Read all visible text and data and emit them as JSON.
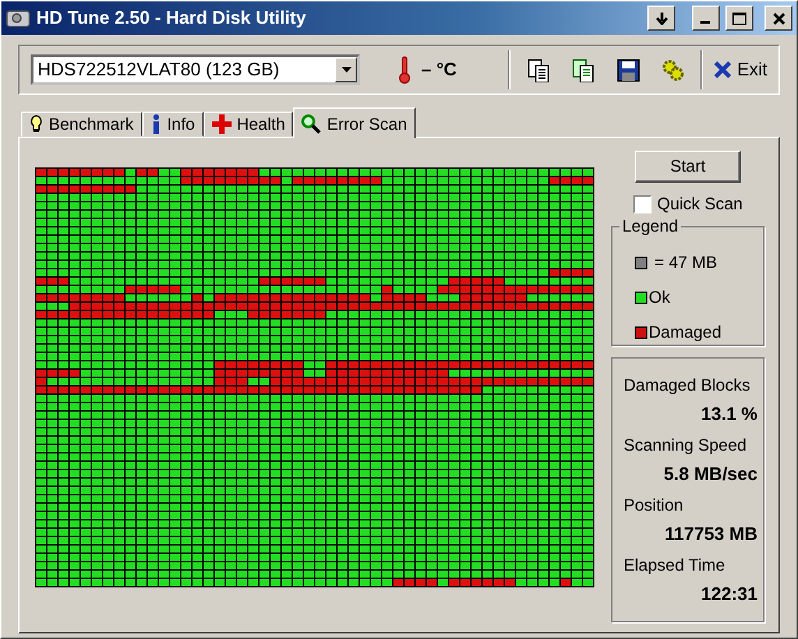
{
  "window": {
    "title": "HD Tune 2.50 - Hard Disk Utility"
  },
  "toolbar": {
    "drive": "HDS722512VLAT80 (123 GB)",
    "temperature": "– °C",
    "exit": "Exit"
  },
  "tabs": [
    {
      "label": "Benchmark",
      "selected": false
    },
    {
      "label": "Info",
      "selected": false
    },
    {
      "label": "Health",
      "selected": false
    },
    {
      "label": "Error Scan",
      "selected": true
    }
  ],
  "scan_map": {
    "rows": [
      [
        true,
        true,
        true,
        true,
        true,
        true,
        true,
        true,
        false,
        true,
        true,
        false,
        false,
        true,
        true,
        true,
        true,
        true,
        true,
        true,
        false,
        false,
        false,
        false,
        false,
        false,
        false,
        false,
        false,
        false,
        false,
        false,
        false,
        false,
        false,
        false,
        false,
        false,
        false,
        false,
        false,
        false,
        false,
        false,
        false,
        false,
        false,
        false,
        false,
        false
      ],
      [
        false,
        false,
        false,
        false,
        false,
        false,
        false,
        false,
        false,
        false,
        false,
        false,
        false,
        true,
        true,
        true,
        true,
        true,
        true,
        true,
        true,
        true,
        false,
        true,
        true,
        true,
        true,
        true,
        true,
        true,
        true,
        false,
        false,
        false,
        false,
        false,
        false,
        false,
        false,
        false,
        false,
        false,
        false,
        false,
        false,
        false,
        true,
        true,
        true,
        true
      ],
      [
        true,
        true,
        true,
        true,
        true,
        true,
        true,
        true,
        true,
        false,
        false,
        false,
        false,
        false,
        false,
        false,
        false,
        false,
        false,
        false,
        false,
        false,
        false,
        false,
        false,
        false,
        false,
        false,
        false,
        false,
        false,
        false,
        false,
        false,
        false,
        false,
        false,
        false,
        false,
        false,
        false,
        false,
        false,
        false,
        false,
        false,
        false,
        false,
        false,
        false
      ],
      [
        false,
        false,
        false,
        false,
        false,
        false,
        false,
        false,
        false,
        false,
        false,
        false,
        false,
        false,
        false,
        false,
        false,
        false,
        false,
        false,
        false,
        false,
        false,
        false,
        false,
        false,
        false,
        false,
        false,
        false,
        false,
        false,
        false,
        false,
        false,
        false,
        false,
        false,
        false,
        false,
        false,
        false,
        false,
        false,
        false,
        false,
        false,
        false,
        false,
        false
      ],
      [
        false,
        false,
        false,
        false,
        false,
        false,
        false,
        false,
        false,
        false,
        false,
        false,
        false,
        false,
        false,
        false,
        false,
        false,
        false,
        false,
        false,
        false,
        false,
        false,
        false,
        false,
        false,
        false,
        false,
        false,
        false,
        false,
        false,
        false,
        false,
        false,
        false,
        false,
        false,
        false,
        false,
        false,
        false,
        false,
        false,
        false,
        false,
        false,
        false,
        false
      ],
      [
        false,
        false,
        false,
        false,
        false,
        false,
        false,
        false,
        false,
        false,
        false,
        false,
        false,
        false,
        false,
        false,
        false,
        false,
        false,
        false,
        false,
        false,
        false,
        false,
        false,
        false,
        false,
        false,
        false,
        false,
        false,
        false,
        false,
        false,
        false,
        false,
        false,
        false,
        false,
        false,
        false,
        false,
        false,
        false,
        false,
        false,
        false,
        false,
        false,
        false
      ],
      [
        false,
        false,
        false,
        false,
        false,
        false,
        false,
        false,
        false,
        false,
        false,
        false,
        false,
        false,
        false,
        false,
        false,
        false,
        false,
        false,
        false,
        false,
        false,
        false,
        false,
        false,
        false,
        false,
        false,
        false,
        false,
        false,
        false,
        false,
        false,
        false,
        false,
        false,
        false,
        false,
        false,
        false,
        false,
        false,
        false,
        false,
        false,
        false,
        false,
        false
      ],
      [
        false,
        false,
        false,
        false,
        false,
        false,
        false,
        false,
        false,
        false,
        false,
        false,
        false,
        false,
        false,
        false,
        false,
        false,
        false,
        false,
        false,
        false,
        false,
        false,
        false,
        false,
        false,
        false,
        false,
        false,
        false,
        false,
        false,
        false,
        false,
        false,
        false,
        false,
        false,
        false,
        false,
        false,
        false,
        false,
        false,
        false,
        false,
        false,
        false,
        false
      ],
      [
        false,
        false,
        false,
        false,
        false,
        false,
        false,
        false,
        false,
        false,
        false,
        false,
        false,
        false,
        false,
        false,
        false,
        false,
        false,
        false,
        false,
        false,
        false,
        false,
        false,
        false,
        false,
        false,
        false,
        false,
        false,
        false,
        false,
        false,
        false,
        false,
        false,
        false,
        false,
        false,
        false,
        false,
        false,
        false,
        false,
        false,
        false,
        false,
        false,
        false
      ],
      [
        false,
        false,
        false,
        false,
        false,
        false,
        false,
        false,
        false,
        false,
        false,
        false,
        false,
        false,
        false,
        false,
        false,
        false,
        false,
        false,
        false,
        false,
        false,
        false,
        false,
        false,
        false,
        false,
        false,
        false,
        false,
        false,
        false,
        false,
        false,
        false,
        false,
        false,
        false,
        false,
        false,
        false,
        false,
        false,
        false,
        false,
        false,
        false,
        false,
        false
      ],
      [
        false,
        false,
        false,
        false,
        false,
        false,
        false,
        false,
        false,
        false,
        false,
        false,
        false,
        false,
        false,
        false,
        false,
        false,
        false,
        false,
        false,
        false,
        false,
        false,
        false,
        false,
        false,
        false,
        false,
        false,
        false,
        false,
        false,
        false,
        false,
        false,
        false,
        false,
        false,
        false,
        false,
        false,
        false,
        false,
        false,
        false,
        false,
        false,
        false,
        false
      ],
      [
        false,
        false,
        false,
        false,
        false,
        false,
        false,
        false,
        false,
        false,
        false,
        false,
        false,
        false,
        false,
        false,
        false,
        false,
        false,
        false,
        false,
        false,
        false,
        false,
        false,
        false,
        false,
        false,
        false,
        false,
        false,
        false,
        false,
        false,
        false,
        false,
        false,
        false,
        false,
        false,
        false,
        false,
        false,
        false,
        false,
        false,
        false,
        false,
        false,
        false
      ],
      [
        false,
        false,
        false,
        false,
        false,
        false,
        false,
        false,
        false,
        false,
        false,
        false,
        false,
        false,
        false,
        false,
        false,
        false,
        false,
        false,
        false,
        false,
        false,
        false,
        false,
        false,
        false,
        false,
        false,
        false,
        false,
        false,
        false,
        false,
        false,
        false,
        false,
        false,
        false,
        false,
        false,
        false,
        false,
        false,
        false,
        false,
        true,
        true,
        true,
        true
      ],
      [
        true,
        true,
        true,
        false,
        false,
        false,
        false,
        false,
        false,
        false,
        false,
        false,
        false,
        false,
        false,
        false,
        false,
        false,
        false,
        false,
        true,
        true,
        true,
        true,
        true,
        true,
        false,
        false,
        false,
        false,
        false,
        false,
        false,
        false,
        false,
        false,
        false,
        true,
        true,
        true,
        true,
        true,
        false,
        false,
        false,
        false,
        false,
        false,
        false,
        false
      ],
      [
        false,
        false,
        false,
        false,
        false,
        false,
        false,
        false,
        true,
        true,
        true,
        true,
        true,
        false,
        false,
        false,
        false,
        false,
        false,
        false,
        false,
        false,
        false,
        false,
        false,
        false,
        false,
        false,
        false,
        false,
        false,
        true,
        false,
        false,
        false,
        false,
        true,
        true,
        true,
        true,
        true,
        true,
        true,
        true,
        true,
        true,
        true,
        true,
        true,
        true
      ],
      [
        true,
        true,
        true,
        true,
        true,
        true,
        true,
        true,
        false,
        false,
        false,
        false,
        false,
        false,
        true,
        false,
        true,
        true,
        true,
        true,
        true,
        true,
        true,
        true,
        true,
        true,
        true,
        true,
        true,
        true,
        false,
        true,
        true,
        true,
        true,
        false,
        false,
        false,
        true,
        true,
        true,
        true,
        true,
        true,
        false,
        false,
        false,
        false,
        false,
        false
      ],
      [
        false,
        false,
        false,
        true,
        true,
        true,
        true,
        true,
        true,
        true,
        true,
        true,
        true,
        true,
        true,
        true,
        true,
        true,
        true,
        true,
        true,
        true,
        true,
        true,
        true,
        true,
        true,
        true,
        true,
        true,
        true,
        true,
        true,
        true,
        true,
        true,
        true,
        true,
        true,
        true,
        true,
        true,
        true,
        true,
        true,
        true,
        true,
        true,
        true,
        true
      ],
      [
        true,
        true,
        true,
        true,
        true,
        true,
        true,
        true,
        true,
        true,
        true,
        true,
        true,
        true,
        true,
        true,
        false,
        false,
        false,
        true,
        true,
        true,
        true,
        true,
        true,
        true,
        false,
        false,
        false,
        false,
        false,
        false,
        false,
        false,
        false,
        false,
        false,
        false,
        false,
        false,
        false,
        false,
        false,
        false,
        false,
        false,
        false,
        false,
        false,
        false
      ],
      [
        false,
        false,
        false,
        false,
        false,
        false,
        false,
        false,
        false,
        false,
        false,
        false,
        false,
        false,
        false,
        false,
        false,
        false,
        false,
        false,
        false,
        false,
        false,
        false,
        false,
        false,
        false,
        false,
        false,
        false,
        false,
        false,
        false,
        false,
        false,
        false,
        false,
        false,
        false,
        false,
        false,
        false,
        false,
        false,
        false,
        false,
        false,
        false,
        false,
        false
      ],
      [
        false,
        false,
        false,
        false,
        false,
        false,
        false,
        false,
        false,
        false,
        false,
        false,
        false,
        false,
        false,
        false,
        false,
        false,
        false,
        false,
        false,
        false,
        false,
        false,
        false,
        false,
        false,
        false,
        false,
        false,
        false,
        false,
        false,
        false,
        false,
        false,
        false,
        false,
        false,
        false,
        false,
        false,
        false,
        false,
        false,
        false,
        false,
        false,
        false,
        false
      ],
      [
        false,
        false,
        false,
        false,
        false,
        false,
        false,
        false,
        false,
        false,
        false,
        false,
        false,
        false,
        false,
        false,
        false,
        false,
        false,
        false,
        false,
        false,
        false,
        false,
        false,
        false,
        false,
        false,
        false,
        false,
        false,
        false,
        false,
        false,
        false,
        false,
        false,
        false,
        false,
        false,
        false,
        false,
        false,
        false,
        false,
        false,
        false,
        false,
        false,
        false
      ],
      [
        false,
        false,
        false,
        false,
        false,
        false,
        false,
        false,
        false,
        false,
        false,
        false,
        false,
        false,
        false,
        false,
        false,
        false,
        false,
        false,
        false,
        false,
        false,
        false,
        false,
        false,
        false,
        false,
        false,
        false,
        false,
        false,
        false,
        false,
        false,
        false,
        false,
        false,
        false,
        false,
        false,
        false,
        false,
        false,
        false,
        false,
        false,
        false,
        false,
        false
      ],
      [
        false,
        false,
        false,
        false,
        false,
        false,
        false,
        false,
        false,
        false,
        false,
        false,
        false,
        false,
        false,
        false,
        false,
        false,
        false,
        false,
        false,
        false,
        false,
        false,
        false,
        false,
        false,
        false,
        false,
        false,
        false,
        false,
        false,
        false,
        false,
        false,
        false,
        false,
        false,
        false,
        false,
        false,
        false,
        false,
        false,
        false,
        false,
        false,
        false,
        false
      ],
      [
        false,
        false,
        false,
        false,
        false,
        false,
        false,
        false,
        false,
        false,
        false,
        false,
        false,
        false,
        false,
        false,
        true,
        true,
        true,
        true,
        true,
        true,
        true,
        true,
        false,
        false,
        true,
        true,
        true,
        true,
        true,
        true,
        true,
        true,
        true,
        true,
        true,
        true,
        true,
        true,
        true,
        true,
        true,
        true,
        true,
        true,
        true,
        true,
        true,
        true
      ],
      [
        true,
        true,
        true,
        true,
        false,
        false,
        false,
        false,
        false,
        false,
        false,
        false,
        false,
        false,
        false,
        false,
        true,
        true,
        true,
        true,
        true,
        true,
        true,
        true,
        false,
        false,
        true,
        true,
        true,
        true,
        true,
        true,
        true,
        true,
        true,
        true,
        true,
        false,
        false,
        false,
        false,
        false,
        false,
        false,
        false,
        false,
        false,
        false,
        false,
        false
      ],
      [
        true,
        false,
        false,
        false,
        false,
        false,
        false,
        false,
        false,
        false,
        false,
        false,
        false,
        false,
        false,
        false,
        true,
        true,
        true,
        false,
        false,
        true,
        true,
        true,
        true,
        true,
        true,
        true,
        true,
        true,
        true,
        true,
        true,
        true,
        true,
        true,
        true,
        true,
        true,
        true,
        true,
        true,
        true,
        true,
        true,
        true,
        true,
        true,
        true,
        true
      ],
      [
        true,
        true,
        true,
        true,
        true,
        true,
        true,
        true,
        true,
        true,
        true,
        true,
        true,
        true,
        true,
        true,
        true,
        true,
        true,
        true,
        true,
        true,
        true,
        true,
        true,
        true,
        true,
        true,
        true,
        true,
        true,
        true,
        true,
        true,
        true,
        true,
        true,
        true,
        true,
        true,
        false,
        false,
        false,
        false,
        false,
        false,
        false,
        false,
        false,
        false
      ],
      [
        false,
        false,
        false,
        false,
        false,
        false,
        false,
        false,
        false,
        false,
        false,
        false,
        false,
        false,
        false,
        false,
        false,
        false,
        false,
        false,
        false,
        false,
        false,
        false,
        false,
        false,
        false,
        false,
        false,
        false,
        false,
        false,
        false,
        false,
        false,
        false,
        false,
        false,
        false,
        false,
        false,
        false,
        false,
        false,
        false,
        false,
        false,
        false,
        false,
        false
      ],
      [
        false,
        false,
        false,
        false,
        false,
        false,
        false,
        false,
        false,
        false,
        false,
        false,
        false,
        false,
        false,
        false,
        false,
        false,
        false,
        false,
        false,
        false,
        false,
        false,
        false,
        false,
        false,
        false,
        false,
        false,
        false,
        false,
        false,
        false,
        false,
        false,
        false,
        false,
        false,
        false,
        false,
        false,
        false,
        false,
        false,
        false,
        false,
        false,
        false,
        false
      ],
      [
        false,
        false,
        false,
        false,
        false,
        false,
        false,
        false,
        false,
        false,
        false,
        false,
        false,
        false,
        false,
        false,
        false,
        false,
        false,
        false,
        false,
        false,
        false,
        false,
        false,
        false,
        false,
        false,
        false,
        false,
        false,
        false,
        false,
        false,
        false,
        false,
        false,
        false,
        false,
        false,
        false,
        false,
        false,
        false,
        false,
        false,
        false,
        false,
        false,
        false
      ],
      [
        false,
        false,
        false,
        false,
        false,
        false,
        false,
        false,
        false,
        false,
        false,
        false,
        false,
        false,
        false,
        false,
        false,
        false,
        false,
        false,
        false,
        false,
        false,
        false,
        false,
        false,
        false,
        false,
        false,
        false,
        false,
        false,
        false,
        false,
        false,
        false,
        false,
        false,
        false,
        false,
        false,
        false,
        false,
        false,
        false,
        false,
        false,
        false,
        false,
        false
      ],
      [
        false,
        false,
        false,
        false,
        false,
        false,
        false,
        false,
        false,
        false,
        false,
        false,
        false,
        false,
        false,
        false,
        false,
        false,
        false,
        false,
        false,
        false,
        false,
        false,
        false,
        false,
        false,
        false,
        false,
        false,
        false,
        false,
        false,
        false,
        false,
        false,
        false,
        false,
        false,
        false,
        false,
        false,
        false,
        false,
        false,
        false,
        false,
        false,
        false,
        false
      ],
      [
        false,
        false,
        false,
        false,
        false,
        false,
        false,
        false,
        false,
        false,
        false,
        false,
        false,
        false,
        false,
        false,
        false,
        false,
        false,
        false,
        false,
        false,
        false,
        false,
        false,
        false,
        false,
        false,
        false,
        false,
        false,
        false,
        false,
        false,
        false,
        false,
        false,
        false,
        false,
        false,
        false,
        false,
        false,
        false,
        false,
        false,
        false,
        false,
        false,
        false
      ],
      [
        false,
        false,
        false,
        false,
        false,
        false,
        false,
        false,
        false,
        false,
        false,
        false,
        false,
        false,
        false,
        false,
        false,
        false,
        false,
        false,
        false,
        false,
        false,
        false,
        false,
        false,
        false,
        false,
        false,
        false,
        false,
        false,
        false,
        false,
        false,
        false,
        false,
        false,
        false,
        false,
        false,
        false,
        false,
        false,
        false,
        false,
        false,
        false,
        false,
        false
      ],
      [
        false,
        false,
        false,
        false,
        false,
        false,
        false,
        false,
        false,
        false,
        false,
        false,
        false,
        false,
        false,
        false,
        false,
        false,
        false,
        false,
        false,
        false,
        false,
        false,
        false,
        false,
        false,
        false,
        false,
        false,
        false,
        false,
        false,
        false,
        false,
        false,
        false,
        false,
        false,
        false,
        false,
        false,
        false,
        false,
        false,
        false,
        false,
        false,
        false,
        false
      ],
      [
        false,
        false,
        false,
        false,
        false,
        false,
        false,
        false,
        false,
        false,
        false,
        false,
        false,
        false,
        false,
        false,
        false,
        false,
        false,
        false,
        false,
        false,
        false,
        false,
        false,
        false,
        false,
        false,
        false,
        false,
        false,
        false,
        false,
        false,
        false,
        false,
        false,
        false,
        false,
        false,
        false,
        false,
        false,
        false,
        false,
        false,
        false,
        false,
        false,
        false
      ],
      [
        false,
        false,
        false,
        false,
        false,
        false,
        false,
        false,
        false,
        false,
        false,
        false,
        false,
        false,
        false,
        false,
        false,
        false,
        false,
        false,
        false,
        false,
        false,
        false,
        false,
        false,
        false,
        false,
        false,
        false,
        false,
        false,
        false,
        false,
        false,
        false,
        false,
        false,
        false,
        false,
        false,
        false,
        false,
        false,
        false,
        false,
        false,
        false,
        false,
        false
      ],
      [
        false,
        false,
        false,
        false,
        false,
        false,
        false,
        false,
        false,
        false,
        false,
        false,
        false,
        false,
        false,
        false,
        false,
        false,
        false,
        false,
        false,
        false,
        false,
        false,
        false,
        false,
        false,
        false,
        false,
        false,
        false,
        false,
        false,
        false,
        false,
        false,
        false,
        false,
        false,
        false,
        false,
        false,
        false,
        false,
        false,
        false,
        false,
        false,
        false,
        false
      ],
      [
        false,
        false,
        false,
        false,
        false,
        false,
        false,
        false,
        false,
        false,
        false,
        false,
        false,
        false,
        false,
        false,
        false,
        false,
        false,
        false,
        false,
        false,
        false,
        false,
        false,
        false,
        false,
        false,
        false,
        false,
        false,
        false,
        false,
        false,
        false,
        false,
        false,
        false,
        false,
        false,
        false,
        false,
        false,
        false,
        false,
        false,
        false,
        false,
        false,
        false
      ],
      [
        false,
        false,
        false,
        false,
        false,
        false,
        false,
        false,
        false,
        false,
        false,
        false,
        false,
        false,
        false,
        false,
        false,
        false,
        false,
        false,
        false,
        false,
        false,
        false,
        false,
        false,
        false,
        false,
        false,
        false,
        false,
        false,
        false,
        false,
        false,
        false,
        false,
        false,
        false,
        false,
        false,
        false,
        false,
        false,
        false,
        false,
        false,
        false,
        false,
        false
      ],
      [
        false,
        false,
        false,
        false,
        false,
        false,
        false,
        false,
        false,
        false,
        false,
        false,
        false,
        false,
        false,
        false,
        false,
        false,
        false,
        false,
        false,
        false,
        false,
        false,
        false,
        false,
        false,
        false,
        false,
        false,
        false,
        false,
        false,
        false,
        false,
        false,
        false,
        false,
        false,
        false,
        false,
        false,
        false,
        false,
        false,
        false,
        false,
        false,
        false,
        false
      ],
      [
        false,
        false,
        false,
        false,
        false,
        false,
        false,
        false,
        false,
        false,
        false,
        false,
        false,
        false,
        false,
        false,
        false,
        false,
        false,
        false,
        false,
        false,
        false,
        false,
        false,
        false,
        false,
        false,
        false,
        false,
        false,
        false,
        false,
        false,
        false,
        false,
        false,
        false,
        false,
        false,
        false,
        false,
        false,
        false,
        false,
        false,
        false,
        false,
        false,
        false
      ],
      [
        false,
        false,
        false,
        false,
        false,
        false,
        false,
        false,
        false,
        false,
        false,
        false,
        false,
        false,
        false,
        false,
        false,
        false,
        false,
        false,
        false,
        false,
        false,
        false,
        false,
        false,
        false,
        false,
        false,
        false,
        false,
        false,
        false,
        false,
        false,
        false,
        false,
        false,
        false,
        false,
        false,
        false,
        false,
        false,
        false,
        false,
        false,
        false,
        false,
        false
      ],
      [
        false,
        false,
        false,
        false,
        false,
        false,
        false,
        false,
        false,
        false,
        false,
        false,
        false,
        false,
        false,
        false,
        false,
        false,
        false,
        false,
        false,
        false,
        false,
        false,
        false,
        false,
        false,
        false,
        false,
        false,
        false,
        false,
        false,
        false,
        false,
        false,
        false,
        false,
        false,
        false,
        false,
        false,
        false,
        false,
        false,
        false,
        false,
        false,
        false,
        false
      ],
      [
        false,
        false,
        false,
        false,
        false,
        false,
        false,
        false,
        false,
        false,
        false,
        false,
        false,
        false,
        false,
        false,
        false,
        false,
        false,
        false,
        false,
        false,
        false,
        false,
        false,
        false,
        false,
        false,
        false,
        false,
        false,
        false,
        false,
        false,
        false,
        false,
        false,
        false,
        false,
        false,
        false,
        false,
        false,
        false,
        false,
        false,
        false,
        false,
        false,
        false
      ],
      [
        false,
        false,
        false,
        false,
        false,
        false,
        false,
        false,
        false,
        false,
        false,
        false,
        false,
        false,
        false,
        false,
        false,
        false,
        false,
        false,
        false,
        false,
        false,
        false,
        false,
        false,
        false,
        false,
        false,
        false,
        false,
        false,
        false,
        false,
        false,
        false,
        false,
        false,
        false,
        false,
        false,
        false,
        false,
        false,
        false,
        false,
        false,
        false,
        false,
        false
      ],
      [
        false,
        false,
        false,
        false,
        false,
        false,
        false,
        false,
        false,
        false,
        false,
        false,
        false,
        false,
        false,
        false,
        false,
        false,
        false,
        false,
        false,
        false,
        false,
        false,
        false,
        false,
        false,
        false,
        false,
        false,
        false,
        false,
        false,
        false,
        false,
        false,
        false,
        false,
        false,
        false,
        false,
        false,
        false,
        false,
        false,
        false,
        false,
        false,
        false,
        false
      ],
      [
        false,
        false,
        false,
        false,
        false,
        false,
        false,
        false,
        false,
        false,
        false,
        false,
        false,
        false,
        false,
        false,
        false,
        false,
        false,
        false,
        false,
        false,
        false,
        false,
        false,
        false,
        false,
        false,
        false,
        false,
        false,
        false,
        false,
        false,
        false,
        false,
        false,
        false,
        false,
        false,
        false,
        false,
        false,
        false,
        false,
        false,
        false,
        false,
        false,
        false
      ],
      [
        false,
        false,
        false,
        false,
        false,
        false,
        false,
        false,
        false,
        false,
        false,
        false,
        false,
        false,
        false,
        false,
        false,
        false,
        false,
        false,
        false,
        false,
        false,
        false,
        false,
        false,
        false,
        false,
        false,
        false,
        false,
        false,
        false,
        false,
        false,
        false,
        false,
        false,
        false,
        false,
        false,
        false,
        false,
        false,
        false,
        false,
        false,
        false,
        false,
        false
      ],
      [
        false,
        false,
        false,
        false,
        false,
        false,
        false,
        false,
        false,
        false,
        false,
        false,
        false,
        false,
        false,
        false,
        false,
        false,
        false,
        false,
        false,
        false,
        false,
        false,
        false,
        false,
        false,
        false,
        false,
        false,
        false,
        false,
        true,
        true,
        true,
        true,
        false,
        true,
        true,
        true,
        true,
        true,
        true,
        false,
        false,
        false,
        false,
        true,
        false,
        false
      ]
    ]
  },
  "controls": {
    "start": "Start",
    "quick_scan": {
      "label": "Quick Scan",
      "checked": false
    }
  },
  "legend": {
    "title": "Legend",
    "items": [
      {
        "label": "= 47 MB",
        "color": "#808080"
      },
      {
        "label": "Ok",
        "color": "#22dd22"
      },
      {
        "label": "Damaged",
        "color": "#cc1010"
      }
    ]
  },
  "stats": [
    {
      "label": "Damaged Blocks",
      "value": "13.1 %"
    },
    {
      "label": "Scanning Speed",
      "value": "5.8 MB/sec"
    },
    {
      "label": "Position",
      "value": "117753 MB"
    },
    {
      "label": "Elapsed Time",
      "value": "122:31"
    }
  ]
}
